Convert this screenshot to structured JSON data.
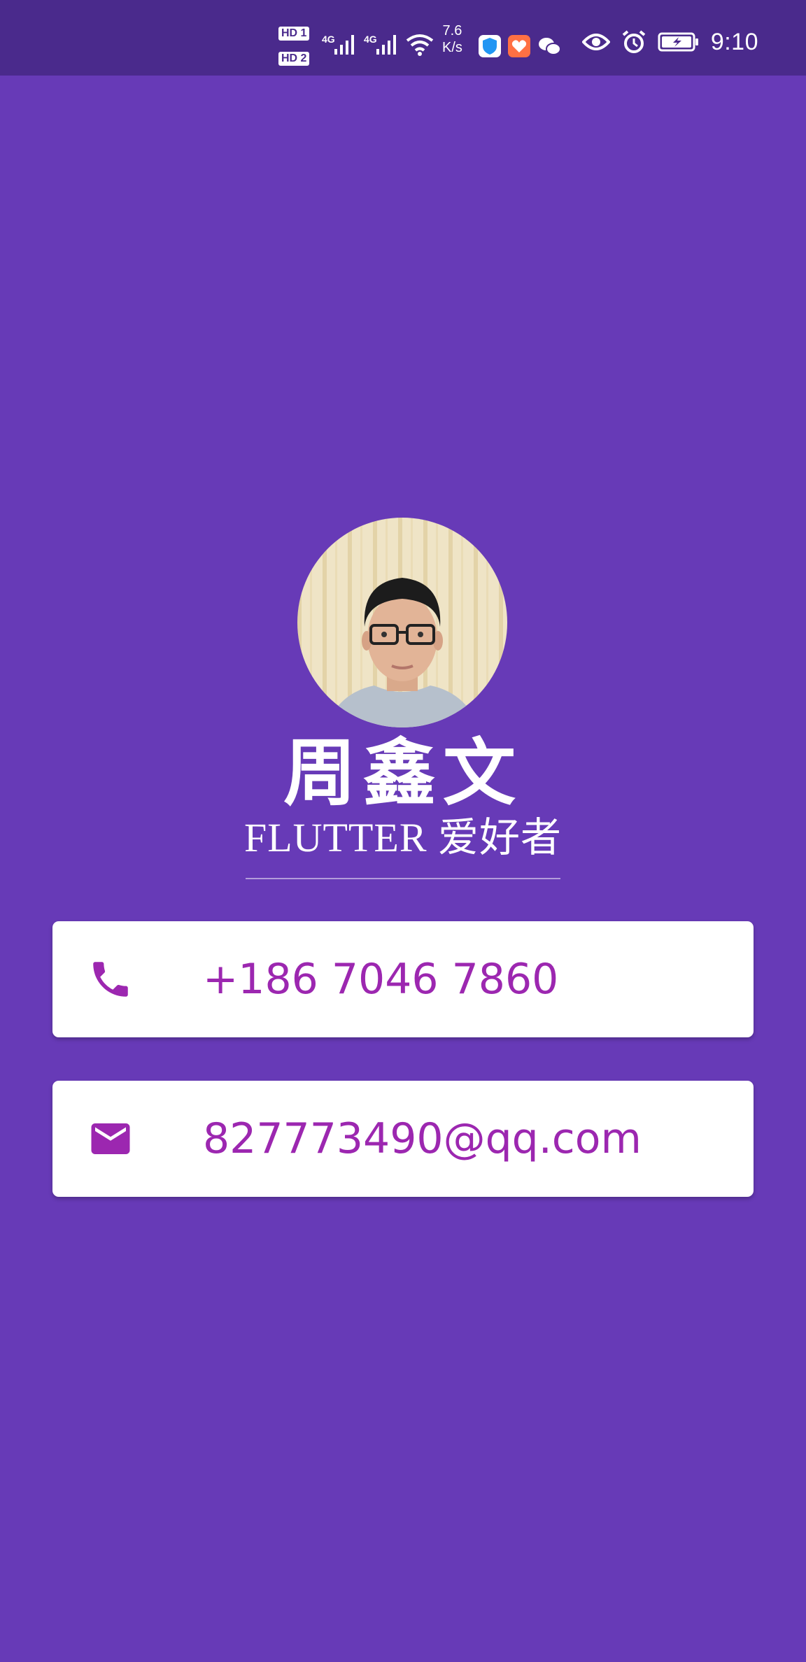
{
  "status_bar": {
    "hd1": "HD 1",
    "hd2": "HD 2",
    "net1": "4G",
    "net2": "4G",
    "speed_value": "7.6",
    "speed_unit": "K/s",
    "time": "9:10"
  },
  "profile": {
    "name": "周鑫文",
    "subtitle": "FLUTTER 爱好者"
  },
  "contacts": {
    "phone": {
      "value": "+186 7046 7860",
      "icon": "phone-icon"
    },
    "email": {
      "value": "827773490@qq.com",
      "icon": "mail-icon"
    }
  },
  "colors": {
    "background": "#673ab7",
    "status_bar": "#4a2a8c",
    "accent": "#9c27b0",
    "card": "#ffffff"
  }
}
